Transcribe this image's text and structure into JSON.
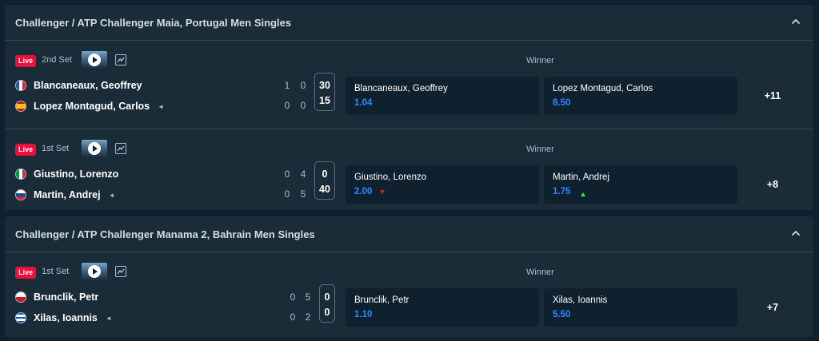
{
  "groups": [
    {
      "title": "Challenger / ATP Challenger Maia, Portugal Men Singles",
      "matches": [
        {
          "live": "Live",
          "period": "2nd Set",
          "market": "Winner",
          "p1": {
            "name": "Blancaneaux, Geoffrey",
            "s1": "1",
            "s2": "0",
            "game": "30"
          },
          "p2": {
            "name": "Lopez Montagud, Carlos",
            "s1": "0",
            "s2": "0",
            "game": "15"
          },
          "serve_marker": "◄",
          "odds": [
            {
              "name": "Blancaneaux, Geoffrey",
              "price": "1.04"
            },
            {
              "name": "Lopez Montagud, Carlos",
              "price": "8.50"
            }
          ],
          "more": "+11"
        },
        {
          "live": "Live",
          "period": "1st Set",
          "market": "Winner",
          "p1": {
            "name": "Giustino, Lorenzo",
            "s1": "0",
            "s2": "4",
            "game": "0"
          },
          "p2": {
            "name": "Martin, Andrej",
            "s1": "0",
            "s2": "5",
            "game": "40"
          },
          "serve_marker": "◄",
          "odds": [
            {
              "name": "Giustino, Lorenzo",
              "price": "2.00",
              "trend": "down"
            },
            {
              "name": "Martin, Andrej",
              "price": "1.75",
              "trend": "up"
            }
          ],
          "more": "+8"
        }
      ]
    },
    {
      "title": "Challenger / ATP Challenger Manama 2, Bahrain Men Singles",
      "matches": [
        {
          "live": "Live",
          "period": "1st Set",
          "market": "Winner",
          "p1": {
            "name": "Brunclik, Petr",
            "s1": "0",
            "s2": "5",
            "game": "0"
          },
          "p2": {
            "name": "Xilas, Ioannis",
            "s1": "0",
            "s2": "2",
            "game": "0"
          },
          "serve_marker": "◄",
          "odds": [
            {
              "name": "Brunclik, Petr",
              "price": "1.10"
            },
            {
              "name": "Xilas, Ioannis",
              "price": "5.50"
            }
          ],
          "more": "+7"
        }
      ]
    }
  ],
  "colors": {
    "background": "#0f212e",
    "card": "#1a2c38",
    "live": "#e9113c",
    "odds_value": "#2f89ff",
    "trend_up": "#1fff20",
    "trend_down": "#e9113c"
  },
  "icons": {
    "collapse": "chevron-up-icon",
    "stream": "play-icon",
    "stats": "line-chart-icon",
    "serve": "serve-indicator-icon"
  }
}
